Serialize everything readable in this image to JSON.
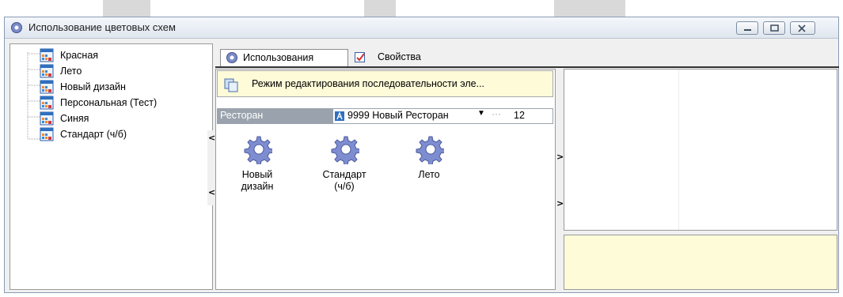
{
  "window": {
    "title": "Использование цветовых схем",
    "buttons": {
      "minimize_icon": "minimize-icon",
      "maximize_icon": "maximize-icon",
      "close_icon": "close-icon"
    }
  },
  "tree": {
    "items": [
      {
        "label": "Красная"
      },
      {
        "label": "Лето"
      },
      {
        "label": "Новый дизайн"
      },
      {
        "label": "Персональная (Тест)"
      },
      {
        "label": "Синяя"
      },
      {
        "label": "Стандарт (ч/б)"
      }
    ]
  },
  "tabs": [
    {
      "label": "Использования",
      "icon": "gear-icon",
      "active": true
    },
    {
      "label": "Свойства",
      "icon": "properties-icon",
      "active": false
    }
  ],
  "banner": {
    "text": "Режим редактирования последовательности эле..."
  },
  "filter": {
    "label": "Ресторан",
    "value": "9999 Новый Ресторан",
    "count": "12"
  },
  "usages": {
    "items": [
      {
        "line1": "Новый",
        "line2": "дизайн"
      },
      {
        "line1": "Стандарт",
        "line2": "(ч/б)"
      },
      {
        "line1": "Лето",
        "line2": ""
      }
    ]
  },
  "colors": {
    "banner_bg": "#fefbd9",
    "filter_bg": "#9aa3ad",
    "note_bg": "#fefbd9",
    "selection": "#2f6fbf"
  }
}
